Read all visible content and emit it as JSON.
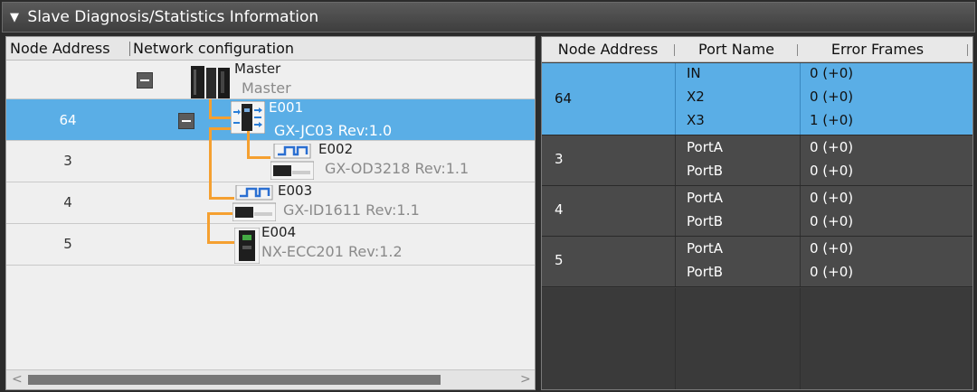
{
  "panel": {
    "title": "Slave Diagnosis/Statistics Information",
    "expand_glyph": "▼"
  },
  "left": {
    "col_node_address": "Node Address",
    "col_network_configuration": "Network configuration",
    "master": {
      "name": "Master",
      "sub": "Master"
    },
    "nodes": [
      {
        "address": "64",
        "name": "E001",
        "model": "GX-JC03 Rev:1.0",
        "icon": "junction-slave-icon"
      },
      {
        "address": "3",
        "name": "E002",
        "model": "GX-OD3218 Rev:1.1",
        "icon": "digital-output-icon"
      },
      {
        "address": "4",
        "name": "E003",
        "model": "GX-ID1611 Rev:1.1",
        "icon": "digital-input-icon"
      },
      {
        "address": "5",
        "name": "E004",
        "model": "NX-ECC201 Rev:1.2",
        "icon": "coupler-icon"
      }
    ],
    "scroll_left": "<",
    "scroll_right": ">"
  },
  "right": {
    "col_node_address": "Node Address",
    "col_port_name": "Port Name",
    "col_error_frames": "Error Frames",
    "rows": [
      {
        "node": "64",
        "ports": [
          {
            "port": "IN",
            "frames": "0 (+0)"
          },
          {
            "port": "X2",
            "frames": "0 (+0)"
          },
          {
            "port": "X3",
            "frames": "1 (+0)"
          }
        ]
      },
      {
        "node": "3",
        "ports": [
          {
            "port": "PortA",
            "frames": "0 (+0)"
          },
          {
            "port": "PortB",
            "frames": "0 (+0)"
          }
        ]
      },
      {
        "node": "4",
        "ports": [
          {
            "port": "PortA",
            "frames": "0 (+0)"
          },
          {
            "port": "PortB",
            "frames": "0 (+0)"
          }
        ]
      },
      {
        "node": "5",
        "ports": [
          {
            "port": "PortA",
            "frames": "0 (+0)"
          },
          {
            "port": "PortB",
            "frames": "0 (+0)"
          }
        ]
      }
    ]
  },
  "colors": {
    "selection": "#5aaee6",
    "tree_line": "#f5a030"
  }
}
